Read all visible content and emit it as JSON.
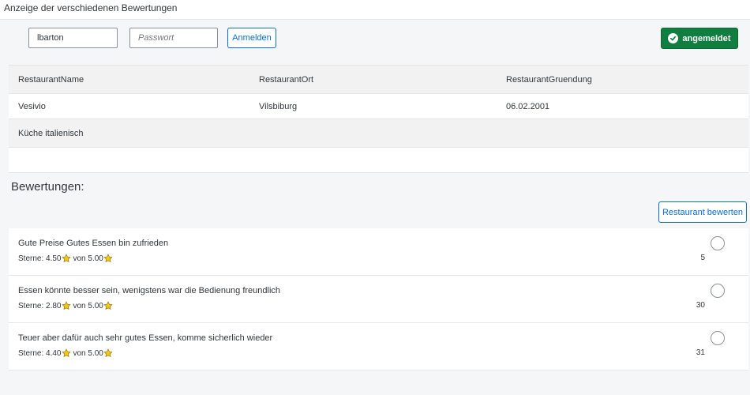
{
  "app": {
    "title": "Anzeige der verschiedenen Bewertungen"
  },
  "login": {
    "username_value": "lbarton",
    "password_placeholder": "Passwort",
    "login_label": "Anmelden",
    "status_label": "angemeldet"
  },
  "restaurant": {
    "headers": [
      "RestaurantName",
      "RestaurantOrt",
      "RestaurantGruendung"
    ],
    "values": [
      "Vesivio",
      "Vilsbiburg",
      "06.02.2001"
    ],
    "cuisine": "Küche italienisch"
  },
  "reviews": {
    "title": "Bewertungen:",
    "rate_button": "Restaurant bewerten",
    "items": [
      {
        "text": "Gute Preise Gutes Essen bin zufrieden",
        "stars_prefix": "Sterne: ",
        "stars": "4.50",
        "of": "von 5.00",
        "id": "5"
      },
      {
        "text": "Essen könnte besser sein, wenigstens war die Bedienung freundlich",
        "stars_prefix": "Sterne: ",
        "stars": "2.80",
        "of": "von 5.00",
        "id": "30"
      },
      {
        "text": "Teuer aber dafür auch sehr gutes Essen, komme sicherlich wieder",
        "stars_prefix": "Sterne: ",
        "stars": "4.40",
        "of": "von 5.00",
        "id": "31"
      }
    ]
  },
  "colors": {
    "accent": "#0a6ed1",
    "success": "#107e3e",
    "star": "#f5c518"
  },
  "icons": {
    "status": "check-icon",
    "rating": "star-icon"
  }
}
